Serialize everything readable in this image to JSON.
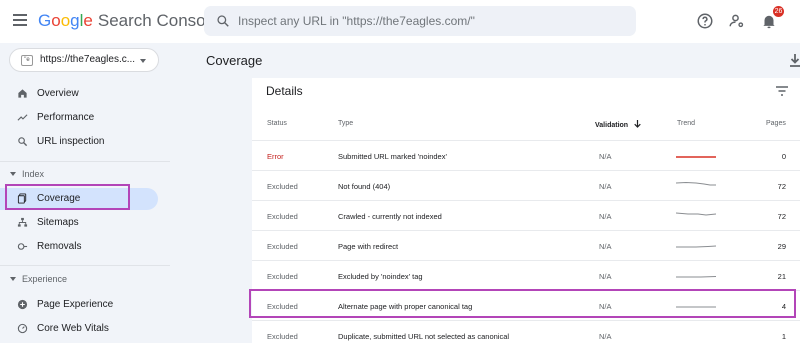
{
  "header": {
    "logo": {
      "google": [
        "G",
        "o",
        "o",
        "g",
        "l",
        "e"
      ],
      "product": "Search Console"
    },
    "search_placeholder": "Inspect any URL in \"https://the7eagles.com/\"",
    "icons": [
      "help-icon",
      "manage-users-icon",
      "notifications-icon"
    ],
    "notification_count": "26"
  },
  "sidebar": {
    "property": {
      "label": "https://the7eagles.c...",
      "favicon_text": "\"e"
    },
    "items_top": [
      {
        "label": "Overview",
        "icon": "home-icon"
      },
      {
        "label": "Performance",
        "icon": "trend-icon"
      },
      {
        "label": "URL inspection",
        "icon": "search-icon"
      }
    ],
    "section_index": "Index",
    "items_index": [
      {
        "label": "Coverage",
        "icon": "coverage-icon",
        "active": true
      },
      {
        "label": "Sitemaps",
        "icon": "sitemaps-icon"
      },
      {
        "label": "Removals",
        "icon": "removals-icon"
      }
    ],
    "section_experience": "Experience",
    "items_experience": [
      {
        "label": "Page Experience",
        "icon": "plus-circle-icon"
      },
      {
        "label": "Core Web Vitals",
        "icon": "gauge-icon"
      }
    ]
  },
  "main": {
    "title": "Coverage",
    "details": {
      "title": "Details",
      "columns": {
        "status": "Status",
        "type": "Type",
        "validation": "Validation",
        "trend": "Trend",
        "pages": "Pages"
      },
      "rows": [
        {
          "status": "Error",
          "type": "Submitted URL marked 'noindex'",
          "validation": "N/A",
          "pages": "0"
        },
        {
          "status": "Excluded",
          "type": "Not found (404)",
          "validation": "N/A",
          "pages": "72"
        },
        {
          "status": "Excluded",
          "type": "Crawled - currently not indexed",
          "validation": "N/A",
          "pages": "72"
        },
        {
          "status": "Excluded",
          "type": "Page with redirect",
          "validation": "N/A",
          "pages": "29"
        },
        {
          "status": "Excluded",
          "type": "Excluded by 'noindex' tag",
          "validation": "N/A",
          "pages": "21"
        },
        {
          "status": "Excluded",
          "type": "Alternate page with proper canonical tag",
          "validation": "N/A",
          "pages": "4"
        },
        {
          "status": "Excluded",
          "type": "Duplicate, submitted URL not selected as canonical",
          "validation": "N/A",
          "pages": "1"
        }
      ]
    }
  },
  "colors": {
    "accent": "#1a73e8",
    "error": "#c5221f",
    "highlight": "#b345b8",
    "active_nav": "#d3e3fd"
  }
}
